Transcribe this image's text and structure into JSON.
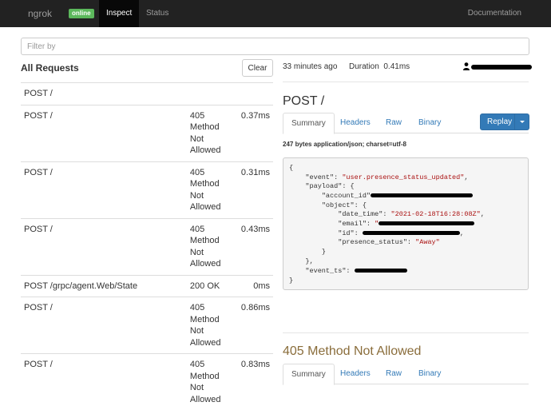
{
  "navbar": {
    "brand": "ngrok",
    "badge": "online",
    "tabs": [
      "Inspect",
      "Status"
    ],
    "documentation": "Documentation"
  },
  "filter": {
    "placeholder": "Filter by"
  },
  "requests": {
    "title": "All Requests",
    "clear_label": "Clear",
    "rows": [
      {
        "method": "POST /",
        "status": "",
        "duration": ""
      },
      {
        "method": "POST /",
        "status": "405 Method Not Allowed",
        "duration": "0.37ms"
      },
      {
        "method": "POST /",
        "status": "405 Method Not Allowed",
        "duration": "0.31ms"
      },
      {
        "method": "POST /",
        "status": "405 Method Not Allowed",
        "duration": "0.43ms"
      },
      {
        "method": "POST /grpc/agent.Web/State",
        "status": "200 OK",
        "duration": "0ms"
      },
      {
        "method": "POST /",
        "status": "405 Method Not Allowed",
        "duration": "0.86ms"
      },
      {
        "method": "POST /",
        "status": "405 Method Not Allowed",
        "duration": "0.83ms"
      }
    ]
  },
  "detail": {
    "time_ago": "33 minutes ago",
    "duration_label": "Duration",
    "duration_value": "0.41ms",
    "title": "POST /",
    "tabs": [
      "Summary",
      "Headers",
      "Raw",
      "Binary"
    ],
    "replay_label": "Replay",
    "content_type": "247 bytes application/json; charset=utf-8",
    "json": {
      "open": "{",
      "event_key": "\"event\": ",
      "event_val": "\"user.presence_status_updated\"",
      "payload_key": "\"payload\": {",
      "account_key": "\"account_id\"",
      "object_key": "\"object\": {",
      "date_key": "\"date_time\": ",
      "date_val": "\"2021-02-18T16:28:08Z\"",
      "email_key": "\"email\": ",
      "id_key": "\"id\": ",
      "presence_key": "\"presence_status\": ",
      "presence_val": "\"Away\"",
      "close_inner": "}",
      "close_payload": "},",
      "event_ts_key": "\"event_ts\": ",
      "close": "}"
    }
  },
  "response": {
    "title": "405 Method Not Allowed",
    "tabs": [
      "Summary",
      "Headers",
      "Raw",
      "Binary"
    ]
  },
  "colors": {
    "navbar": "#222222",
    "online": "#5cb85c",
    "replay": "#337ab7",
    "response_title": "#8a6d3b"
  }
}
